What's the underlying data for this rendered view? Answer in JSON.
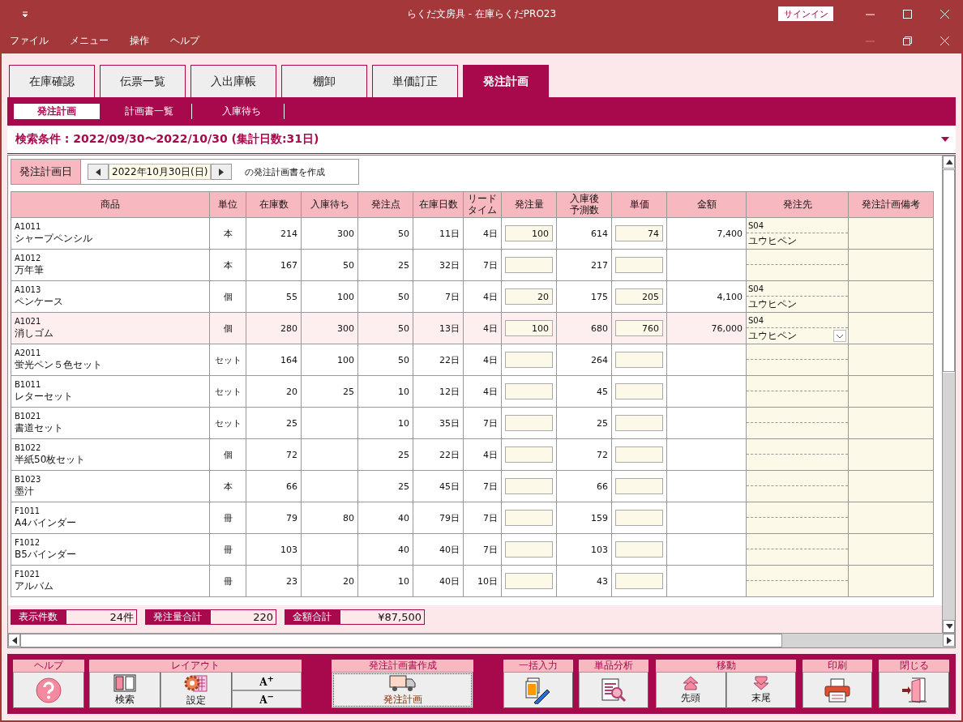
{
  "window": {
    "title": "らくだ文房具  -  在庫らくだPRO23",
    "signin": "サインイン"
  },
  "menu": [
    "ファイル",
    "メニュー",
    "操作",
    "ヘルプ"
  ],
  "tabs": [
    {
      "label": "在庫確認",
      "selected": false
    },
    {
      "label": "伝票一覧",
      "selected": false
    },
    {
      "label": "入出庫帳",
      "selected": false
    },
    {
      "label": "棚卸",
      "selected": false
    },
    {
      "label": "単価訂正",
      "selected": false
    },
    {
      "label": "発注計画",
      "selected": true
    }
  ],
  "subtabs": [
    {
      "label": "発注計画",
      "selected": true
    },
    {
      "label": "計画書一覧",
      "selected": false
    },
    {
      "label": "入庫待ち",
      "selected": false
    }
  ],
  "search_condition": "検索条件 : 2022/09/30〜2022/10/30 (集計日数:31日)",
  "plan_date": {
    "label": "発注計画日",
    "value": "2022年10月30日(日)",
    "suffix": "の発注計画書を作成"
  },
  "table": {
    "columns": [
      "商品",
      "単位",
      "在庫数",
      "入庫待ち",
      "発注点",
      "在庫日数",
      "リードタイム",
      "発注量",
      "入庫後予測数",
      "単価",
      "金額",
      "発注先",
      "発注計画備考"
    ],
    "rows": [
      {
        "code": "A1011",
        "name": "シャープペンシル",
        "unit": "本",
        "stock": "214",
        "incoming": "300",
        "reorder_point": "50",
        "stock_days": "11日",
        "lead_time": "4日",
        "order_qty": "100",
        "forecast": "614",
        "unit_price": "74",
        "amount": "7,400",
        "supplier_code": "S04",
        "supplier_name": "ユウヒペン",
        "selected": false
      },
      {
        "code": "A1012",
        "name": "万年筆",
        "unit": "本",
        "stock": "167",
        "incoming": "50",
        "reorder_point": "25",
        "stock_days": "32日",
        "lead_time": "7日",
        "order_qty": "",
        "forecast": "217",
        "unit_price": "",
        "amount": "",
        "supplier_code": "",
        "supplier_name": "",
        "selected": false
      },
      {
        "code": "A1013",
        "name": "ペンケース",
        "unit": "個",
        "stock": "55",
        "incoming": "100",
        "reorder_point": "50",
        "stock_days": "7日",
        "lead_time": "4日",
        "order_qty": "20",
        "forecast": "175",
        "unit_price": "205",
        "amount": "4,100",
        "supplier_code": "S04",
        "supplier_name": "ユウヒペン",
        "selected": false
      },
      {
        "code": "A1021",
        "name": "消しゴム",
        "unit": "個",
        "stock": "280",
        "incoming": "300",
        "reorder_point": "50",
        "stock_days": "13日",
        "lead_time": "4日",
        "order_qty": "100",
        "forecast": "680",
        "unit_price": "760",
        "amount": "76,000",
        "supplier_code": "S04",
        "supplier_name": "ユウヒペン",
        "selected": true
      },
      {
        "code": "A2011",
        "name": "蛍光ペン５色セット",
        "unit": "セット",
        "stock": "164",
        "incoming": "100",
        "reorder_point": "50",
        "stock_days": "22日",
        "lead_time": "4日",
        "order_qty": "",
        "forecast": "264",
        "unit_price": "",
        "amount": "",
        "supplier_code": "",
        "supplier_name": "",
        "selected": false
      },
      {
        "code": "B1011",
        "name": "レターセット",
        "unit": "セット",
        "stock": "20",
        "incoming": "25",
        "reorder_point": "10",
        "stock_days": "12日",
        "lead_time": "4日",
        "order_qty": "",
        "forecast": "45",
        "unit_price": "",
        "amount": "",
        "supplier_code": "",
        "supplier_name": "",
        "selected": false
      },
      {
        "code": "B1021",
        "name": "書道セット",
        "unit": "セット",
        "stock": "25",
        "incoming": "",
        "reorder_point": "10",
        "stock_days": "35日",
        "lead_time": "7日",
        "order_qty": "",
        "forecast": "25",
        "unit_price": "",
        "amount": "",
        "supplier_code": "",
        "supplier_name": "",
        "selected": false
      },
      {
        "code": "B1022",
        "name": "半紙50枚セット",
        "unit": "個",
        "stock": "72",
        "incoming": "",
        "reorder_point": "25",
        "stock_days": "22日",
        "lead_time": "4日",
        "order_qty": "",
        "forecast": "72",
        "unit_price": "",
        "amount": "",
        "supplier_code": "",
        "supplier_name": "",
        "selected": false
      },
      {
        "code": "B1023",
        "name": "墨汁",
        "unit": "本",
        "stock": "66",
        "incoming": "",
        "reorder_point": "25",
        "stock_days": "45日",
        "lead_time": "7日",
        "order_qty": "",
        "forecast": "66",
        "unit_price": "",
        "amount": "",
        "supplier_code": "",
        "supplier_name": "",
        "selected": false
      },
      {
        "code": "F1011",
        "name": "A4バインダー",
        "unit": "冊",
        "stock": "79",
        "incoming": "80",
        "reorder_point": "40",
        "stock_days": "79日",
        "lead_time": "7日",
        "order_qty": "",
        "forecast": "159",
        "unit_price": "",
        "amount": "",
        "supplier_code": "",
        "supplier_name": "",
        "selected": false
      },
      {
        "code": "F1012",
        "name": "B5バインダー",
        "unit": "冊",
        "stock": "103",
        "incoming": "",
        "reorder_point": "40",
        "stock_days": "40日",
        "lead_time": "7日",
        "order_qty": "",
        "forecast": "103",
        "unit_price": "",
        "amount": "",
        "supplier_code": "",
        "supplier_name": "",
        "selected": false
      },
      {
        "code": "F1021",
        "name": "アルバム",
        "unit": "冊",
        "stock": "23",
        "incoming": "20",
        "reorder_point": "10",
        "stock_days": "40日",
        "lead_time": "10日",
        "order_qty": "",
        "forecast": "43",
        "unit_price": "",
        "amount": "",
        "supplier_code": "",
        "supplier_name": "",
        "selected": false
      }
    ]
  },
  "totals": [
    {
      "label": "表示件数",
      "value": "24件"
    },
    {
      "label": "発注量合計",
      "value": "220"
    },
    {
      "label": "金額合計",
      "value": "¥87,500"
    }
  ],
  "toolbar": [
    {
      "label": "ヘルプ",
      "buttons": [
        {
          "kind": "icon"
        }
      ]
    },
    {
      "label": "レイアウト",
      "buttons": [
        {
          "kind": "icon",
          "label": "検索"
        },
        {
          "kind": "icon",
          "label": "設定"
        },
        {
          "kind": "stack",
          "items": [
            "A$^{+}$",
            "A$^{−}$"
          ]
        }
      ]
    },
    {
      "label": "発注計画書作成",
      "buttons": [
        {
          "kind": "icon",
          "label": "発注計画"
        }
      ]
    },
    {
      "label": "一括入力",
      "buttons": [
        {
          "kind": "icon"
        }
      ]
    },
    {
      "label": "単品分析",
      "buttons": [
        {
          "kind": "icon"
        }
      ]
    },
    {
      "label": "移動",
      "buttons": [
        {
          "kind": "icon",
          "label": "先頭"
        },
        {
          "kind": "icon",
          "label": "末尾"
        }
      ]
    },
    {
      "label": "印刷",
      "buttons": [
        {
          "kind": "icon"
        }
      ]
    },
    {
      "label": "閉じる",
      "buttons": [
        {
          "kind": "icon"
        }
      ]
    }
  ]
}
